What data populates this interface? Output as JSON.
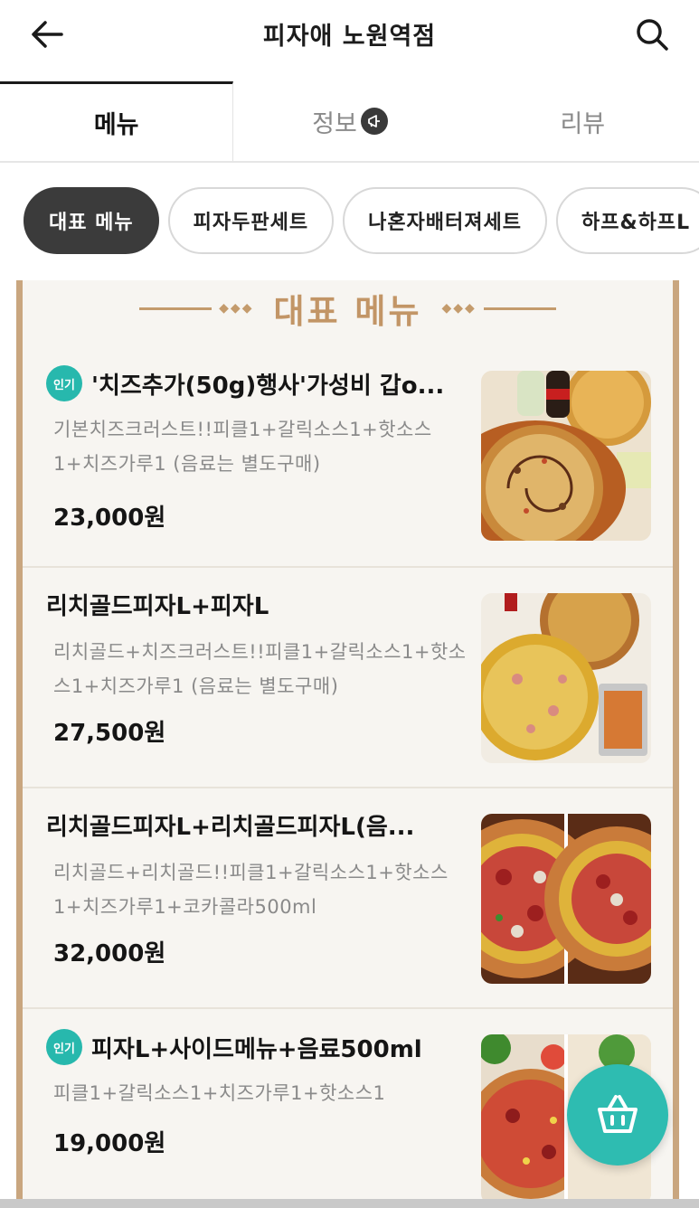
{
  "header": {
    "title": "피자애 노원역점"
  },
  "tabs": [
    {
      "label": "메뉴"
    },
    {
      "label": "정보"
    },
    {
      "label": "리뷰"
    }
  ],
  "chips": [
    {
      "label": "대표 메뉴"
    },
    {
      "label": "피자두판세트"
    },
    {
      "label": "나혼자배터져세트"
    },
    {
      "label": "하프&하프L"
    }
  ],
  "section": {
    "title": "대표 메뉴"
  },
  "items": [
    {
      "badge": "인기",
      "title": "'치즈추가(50g)행사'가성비 갑o...",
      "desc": "기본치즈크러스트!!피클1+갈릭소스1+핫소스1+치즈가루1 (음료는 별도구매)",
      "price": "23,000원"
    },
    {
      "badge": "",
      "title": "리치골드피자L+피자L",
      "desc": "리치골드+치즈크러스트!!피클1+갈릭소스1+핫소스1+치즈가루1 (음료는 별도구매)",
      "price": "27,500원"
    },
    {
      "badge": "",
      "title": "리치골드피자L+리치골드피자L(음...",
      "desc": "리치골드+리치골드!!피클1+갈릭소스1+핫소스1+치즈가루1+코카콜라500ml",
      "price": "32,000원"
    },
    {
      "badge": "인기",
      "title": "피자L+사이드메뉴+음료500ml",
      "desc": "피클1+갈릭소스1+치즈가루1+핫소스1",
      "price": "19,000원"
    }
  ],
  "colors": {
    "accent": "#27b8ad",
    "gold": "#c49b6c",
    "dark_chip": "#3b3b3b"
  }
}
